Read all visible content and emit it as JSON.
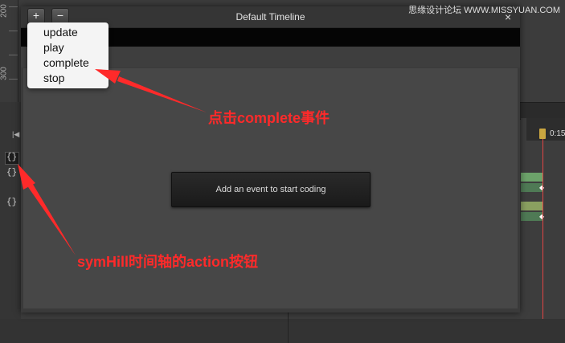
{
  "ruler": {
    "label_upper": "200",
    "label_lower": "300"
  },
  "dialog": {
    "title": "Default Timeline",
    "add_button_glyph": "+",
    "remove_button_glyph": "−",
    "close_glyph": "×",
    "center_button_label": "Add an event to start coding"
  },
  "event_menu": {
    "items": [
      "update",
      "play",
      "complete",
      "stop"
    ]
  },
  "timeline": {
    "time_label": "0:15",
    "action_glyph": "{}",
    "first_frame_glyph": "|◀"
  },
  "annotations": {
    "complete_event": "点击complete事件",
    "action_button": "symHill时间轴的action按钮"
  },
  "watermark": "思缘设计论坛  WWW.MISSYUAN.COM",
  "colors": {
    "annotation": "#ff2a2a",
    "playhead": "#e24444",
    "track_bar_light": "#6ca36a",
    "track_bar_dark": "#4f7a55",
    "track_bar_olive": "#8aa060"
  }
}
